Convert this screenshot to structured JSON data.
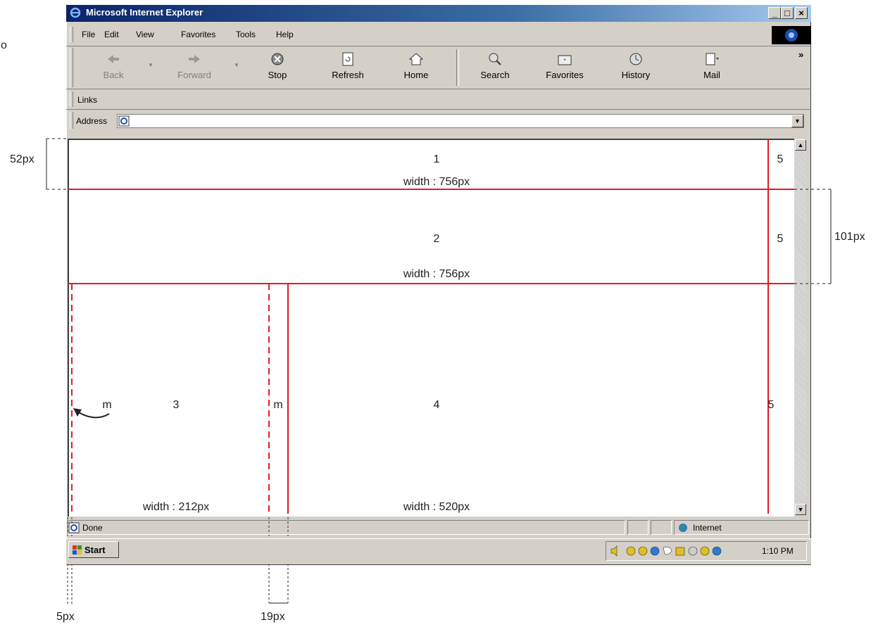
{
  "window": {
    "title": "Microsoft Internet Explorer",
    "minimize": "_",
    "maximize": "□",
    "close": "×"
  },
  "menu": [
    "File",
    "Edit",
    "View",
    "Favorites",
    "Tools",
    "Help"
  ],
  "toolbar": {
    "back": "Back",
    "forward": "Forward",
    "stop": "Stop",
    "refresh": "Refresh",
    "home": "Home",
    "search": "Search",
    "favorites": "Favorites",
    "history": "History",
    "mail": "Mail",
    "more": "»"
  },
  "links_bar": {
    "label": "Links"
  },
  "address_bar": {
    "label": "Address",
    "value": ""
  },
  "layout": {
    "region1": {
      "number": "1",
      "width_label": "width : 756px",
      "side": "5"
    },
    "region2": {
      "number": "2",
      "width_label": "width : 756px",
      "side": "5"
    },
    "region3": {
      "number": "3",
      "width_label": "width : 212px",
      "margin_left": "m"
    },
    "region4": {
      "number": "4",
      "width_label": "width : 520px",
      "margin_left": "m",
      "side": "5"
    }
  },
  "annotations": {
    "height1": "52px",
    "height2": "101px",
    "left_margin": "5px",
    "gutter": "19px",
    "edge_text": "o"
  },
  "status": {
    "text": "Done",
    "zone": "Internet"
  },
  "taskbar": {
    "start": "Start",
    "clock": "1:10 PM"
  },
  "colors": {
    "title_bar": "#0a246a",
    "guide_line": "#e31b23",
    "chrome": "#d4d0c8"
  }
}
